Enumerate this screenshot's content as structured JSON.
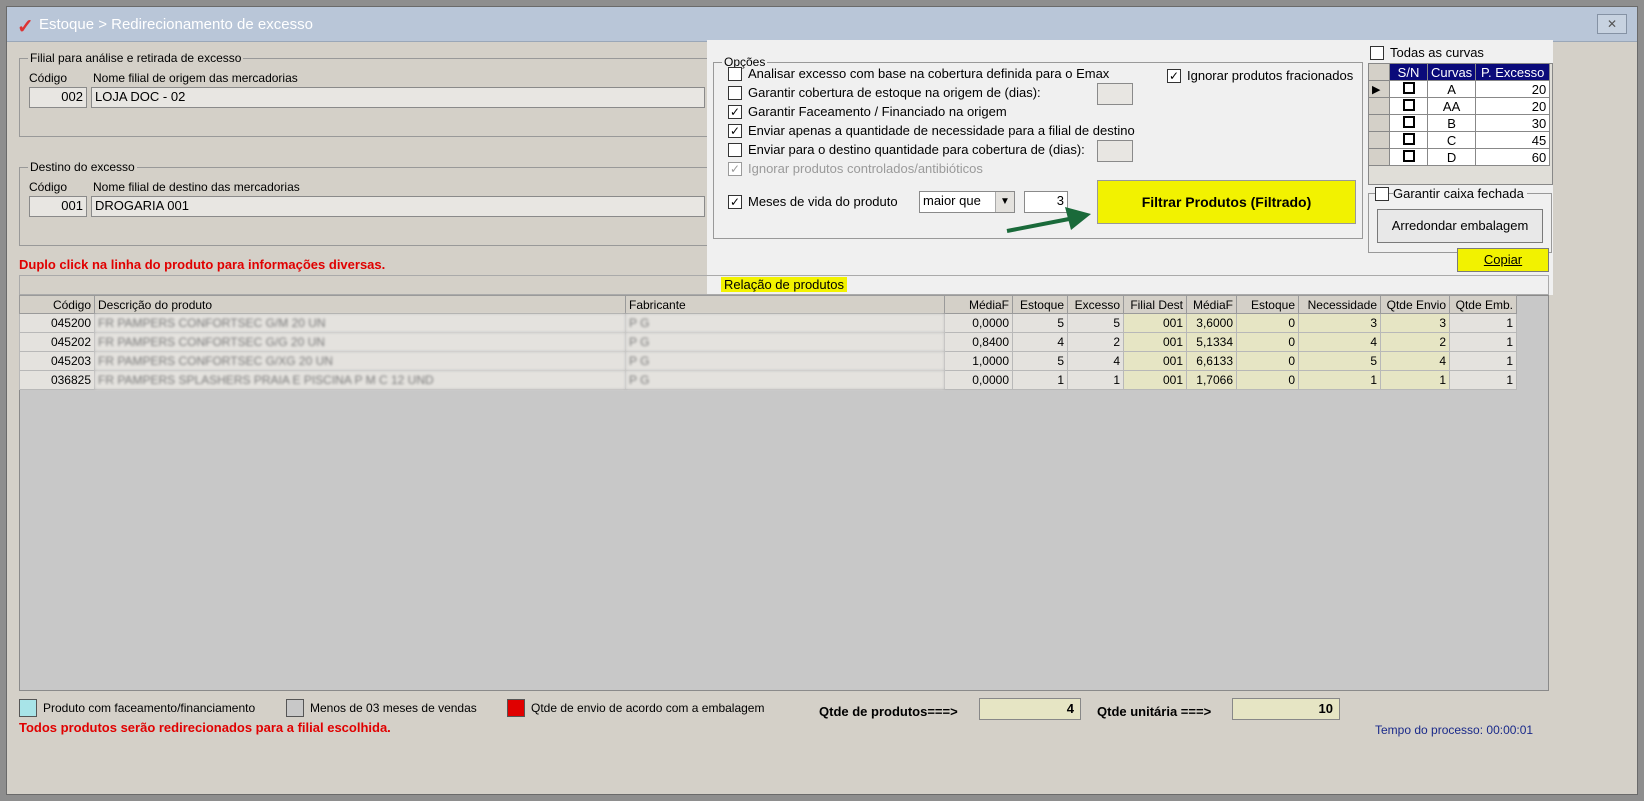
{
  "window": {
    "title": "Estoque > Redirecionamento de excesso",
    "close_label": "✕"
  },
  "origin": {
    "legend": "Filial para análise e retirada de excesso",
    "code_label": "Código",
    "name_label": "Nome filial de origem das mercadorias",
    "code": "002",
    "name": "LOJA DOC - 02"
  },
  "destination": {
    "legend": "Destino do excesso",
    "code_label": "Código",
    "name_label": "Nome filial de destino das mercadorias",
    "code": "001",
    "name": "DROGARIA 001"
  },
  "hint": "Duplo click na linha do produto para informações diversas.",
  "options": {
    "legend": "Opções",
    "items": [
      {
        "label": "Analisar excesso com base na cobertura definida para o Emax",
        "checked": false,
        "mark": ""
      },
      {
        "label": "Garantir cobertura de estoque na origem de (dias):",
        "checked": false,
        "mark": ""
      },
      {
        "label": "Garantir Faceamento / Financiado na origem",
        "checked": true,
        "mark": "✓"
      },
      {
        "label": "Enviar apenas a quantidade de necessidade para a filial de destino",
        "checked": true,
        "mark": "✓"
      },
      {
        "label": "Enviar para o destino quantidade para cobertura de (dias):",
        "checked": false,
        "mark": ""
      },
      {
        "label": "Ignorar produtos controlados/antibióticos",
        "checked": true,
        "disabled": true,
        "mark": "✓"
      }
    ],
    "ignore_fractional": {
      "label": "Ignorar produtos fracionados",
      "checked": true,
      "mark": "✓"
    },
    "months": {
      "label": "Meses de vida do produto",
      "checked": true,
      "mark": "✓",
      "operator": "maior que",
      "value": "3"
    },
    "coverage_origin_days": "",
    "coverage_dest_days": ""
  },
  "filter_button": "Filtrar Produtos (Filtrado)",
  "curves": {
    "all_label": "Todas as curvas",
    "all_mark": "",
    "headers": [
      "S/N",
      "Curvas",
      "P. Excesso"
    ],
    "rows": [
      {
        "curve": "A",
        "pct": "20",
        "mark": ""
      },
      {
        "curve": "AA",
        "pct": "20",
        "mark": ""
      },
      {
        "curve": "B",
        "pct": "30",
        "mark": ""
      },
      {
        "curve": "C",
        "pct": "45",
        "mark": ""
      },
      {
        "curve": "D",
        "pct": "60",
        "mark": ""
      }
    ],
    "row_pointer": "▶"
  },
  "packaging": {
    "label": "Garantir caixa fechada",
    "mark": "",
    "button": "Arredondar embalagem"
  },
  "copy_button": "Copiar",
  "products_tab": "Relação de produtos",
  "grid": {
    "headers": [
      "Código",
      "Descrição do produto",
      "Fabricante",
      "MédiaF",
      "Estoque",
      "Excesso",
      "Filial Dest",
      "MédiaF",
      "Estoque",
      "Necessidade",
      "Qtde Envio",
      "Qtde Emb."
    ],
    "rows": [
      [
        "045200",
        "FR PAMPERS CONFORTSEC G/M 20 UN",
        "P G",
        "0,0000",
        "5",
        "5",
        "001",
        "3,6000",
        "0",
        "3",
        "3",
        "1"
      ],
      [
        "045202",
        "FR PAMPERS CONFORTSEC G/G 20 UN",
        "P G",
        "0,8400",
        "4",
        "2",
        "001",
        "5,1334",
        "0",
        "4",
        "2",
        "1"
      ],
      [
        "045203",
        "FR PAMPERS CONFORTSEC G/XG 20 UN",
        "P G",
        "1,0000",
        "5",
        "4",
        "001",
        "6,6133",
        "0",
        "5",
        "4",
        "1"
      ],
      [
        "036825",
        "FR PAMPERS SPLASHERS PRAIA E PISCINA P M C 12 UND",
        "P G",
        "0,0000",
        "1",
        "1",
        "001",
        "1,7066",
        "0",
        "1",
        "1",
        "1"
      ]
    ]
  },
  "legend": {
    "faceamento": {
      "label": "Produto com faceamento/financiamento",
      "color": "#a8e4e8"
    },
    "menos3": {
      "label": "Menos de 03 meses de vendas",
      "color": "#c8c8c8"
    },
    "embalagem": {
      "label": "Qtde de envio de acordo com a embalagem",
      "color": "#e00000"
    }
  },
  "summary": {
    "qty_products_label": "Qtde de produtos===>",
    "qty_products": "4",
    "qty_units_label": "Qtde unitária ===>",
    "qty_units": "10"
  },
  "footer_warning": "Todos produtos serão redirecionados para a filial escolhida.",
  "process_time": "Tempo do processo: 00:00:01"
}
